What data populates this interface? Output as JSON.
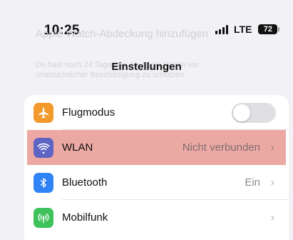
{
  "status": {
    "time": "10:25",
    "network": "LTE",
    "battery": "72"
  },
  "background": {
    "title": "Apple Watch-Abdeckung hinzufügen",
    "subtitle": "Du hast noch 24 Tage, um die Apple Watch vor unabsichtlicher Beschädigung zu schützen."
  },
  "header": {
    "title": "Einstellungen"
  },
  "settings": {
    "items": [
      {
        "label": "Flugmodus",
        "icon": "airplane-icon",
        "color": "#f39a2d",
        "control": "toggle",
        "toggle_on": false
      },
      {
        "label": "WLAN",
        "value": "Nicht verbunden",
        "icon": "wifi-icon",
        "color": "#5e63c4",
        "highlighted": true
      },
      {
        "label": "Bluetooth",
        "value": "Ein",
        "icon": "bluetooth-icon",
        "color": "#2f83f5"
      },
      {
        "label": "Mobilfunk",
        "value": "",
        "icon": "antenna-icon",
        "color": "#3fc25b"
      }
    ]
  },
  "chevron": "›"
}
